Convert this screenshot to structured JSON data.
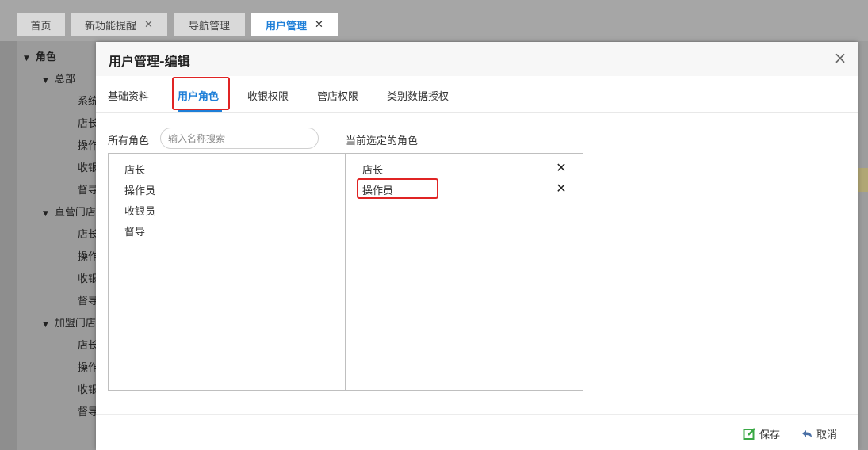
{
  "tabs": [
    {
      "label": "首页",
      "closable": false
    },
    {
      "label": "新功能提醒",
      "closable": true
    },
    {
      "label": "导航管理",
      "closable": false
    },
    {
      "label": "用户管理",
      "closable": true,
      "active": true
    }
  ],
  "tab_close_glyph": "✕",
  "tree": {
    "root": "角色",
    "groups": [
      {
        "label": "总部",
        "children": [
          "系统",
          "店长",
          "操作",
          "收银",
          "督导"
        ]
      },
      {
        "label": "直营门店",
        "children": [
          "店长",
          "操作",
          "收银",
          "督导"
        ]
      },
      {
        "label": "加盟门店",
        "children": [
          "店长",
          "操作",
          "收银",
          "督导"
        ]
      }
    ]
  },
  "modal": {
    "title": "用户管理-编辑",
    "close_glyph": "×",
    "subtabs": [
      "基础资料",
      "用户角色",
      "收银权限",
      "管店权限",
      "类别数据授权"
    ],
    "active_subtab": "用户角色",
    "all_roles_label": "所有角色",
    "search_placeholder": "输入名称搜索",
    "selected_roles_label": "当前选定的角色",
    "all_roles": [
      "店长",
      "操作员",
      "收银员",
      "督导"
    ],
    "selected_roles": [
      "店长",
      "操作员"
    ],
    "remove_glyph": "✕",
    "footer": {
      "save_label": "保存",
      "cancel_label": "取消"
    }
  },
  "colors": {
    "accent": "#1e7fd8",
    "annotation": "#e02424",
    "save_icon": "#3aa845"
  }
}
